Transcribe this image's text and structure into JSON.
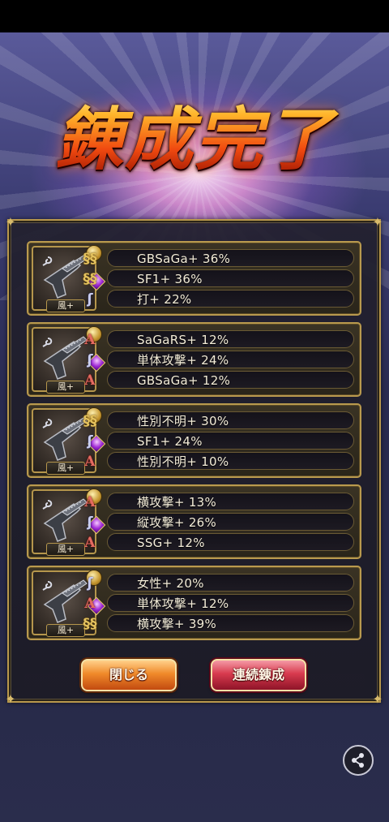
{
  "title": "錬成完了",
  "buttons": {
    "close": "閉じる",
    "continue": "連続錬成"
  },
  "results": [
    {
      "element_tag": "風+",
      "stats": [
        {
          "icon": "gold-double-spiral-icon",
          "text": "GBSaGa+ 36%"
        },
        {
          "icon": "gold-double-spiral-icon",
          "text": "SF1+ 36%"
        },
        {
          "icon": "blue-spiral-icon",
          "text": "打+ 22%"
        }
      ]
    },
    {
      "element_tag": "風+",
      "stats": [
        {
          "icon": "red-a-icon",
          "text": "SaGaRS+ 12%"
        },
        {
          "icon": "blue-spiral-icon",
          "text": "単体攻撃+ 24%"
        },
        {
          "icon": "red-a-icon",
          "text": "GBSaGa+ 12%"
        }
      ]
    },
    {
      "element_tag": "風+",
      "stats": [
        {
          "icon": "gold-double-spiral-icon",
          "text": "性別不明+ 30%"
        },
        {
          "icon": "blue-spiral-icon",
          "text": "SF1+ 24%"
        },
        {
          "icon": "red-a-icon",
          "text": "性別不明+ 10%"
        }
      ]
    },
    {
      "element_tag": "風+",
      "stats": [
        {
          "icon": "red-a-icon",
          "text": "横攻撃+ 13%"
        },
        {
          "icon": "blue-spiral-icon",
          "text": "縦攻撃+ 26%"
        },
        {
          "icon": "red-a-icon",
          "text": "SSG+ 12%"
        }
      ]
    },
    {
      "element_tag": "風+",
      "stats": [
        {
          "icon": "blue-spiral-icon",
          "text": "女性+ 20%"
        },
        {
          "icon": "red-a-icon",
          "text": "単体攻撃+ 12%"
        },
        {
          "icon": "gold-double-spiral-icon",
          "text": "横攻撃+ 39%"
        }
      ]
    }
  ],
  "colors": {
    "gold_frame": "#b99a4e",
    "title_orange": "#f04a10",
    "close_button": "#f08a2a",
    "continue_button": "#d83a4e"
  }
}
